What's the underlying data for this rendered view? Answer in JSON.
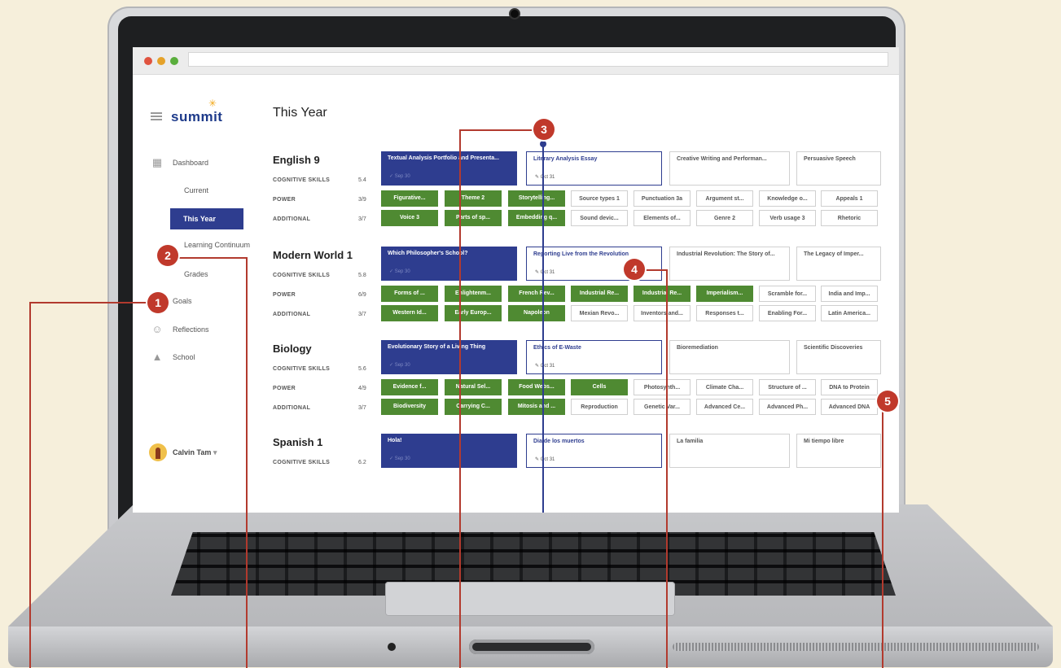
{
  "app": {
    "logo": "summit",
    "page_title": "This Year"
  },
  "sidebar": {
    "items": [
      {
        "label": "Dashboard",
        "icon": "dashboard-icon"
      },
      {
        "label": "Current"
      },
      {
        "label": "This Year",
        "selected": true
      },
      {
        "label": "Learning Continuum"
      },
      {
        "label": "Grades"
      },
      {
        "label": "Goals",
        "icon": "target-icon"
      },
      {
        "label": "Reflections",
        "icon": "smile-icon"
      },
      {
        "label": "School",
        "icon": "graduation-cap-icon"
      }
    ],
    "user": {
      "name": "Calvin Tam",
      "dropdown": "▾"
    }
  },
  "courses": [
    {
      "title": "English 9",
      "rows": [
        {
          "label": "COGNITIVE SKILLS",
          "score": "5.4"
        },
        {
          "label": "POWER",
          "score": "3/9"
        },
        {
          "label": "ADDITIONAL",
          "score": "3/7"
        }
      ],
      "projects": [
        {
          "title": "Textual Analysis Portfolio and Presenta...",
          "date": "✓ Sep 30"
        },
        {
          "title": "Literary Analysis Essay",
          "date": "✎ Oct 31"
        },
        {
          "title": "Creative Writing and Performan..."
        },
        {
          "title": "Persuasive Speech"
        }
      ],
      "power": [
        "Figurative...",
        "Theme 2",
        "Storytelling...",
        "Source types 1",
        "Punctuation 3a",
        "Argument st...",
        "Knowledge o...",
        "Appeals 1"
      ],
      "additional": [
        "Voice 3",
        "Parts of sp...",
        "Embedding q...",
        "Sound devic...",
        "Elements of...",
        "Genre 2",
        "Verb usage 3",
        "Rhetoric"
      ]
    },
    {
      "title": "Modern World 1",
      "rows": [
        {
          "label": "COGNITIVE SKILLS",
          "score": "5.8"
        },
        {
          "label": "POWER",
          "score": "6/9"
        },
        {
          "label": "ADDITIONAL",
          "score": "3/7"
        }
      ],
      "projects": [
        {
          "title": "Which Philosopher's School?",
          "date": "✓ Sep 30"
        },
        {
          "title": "Reporting Live from the Revolution",
          "date": "✎ Oct 31"
        },
        {
          "title": "Industrial Revolution: The Story of..."
        },
        {
          "title": "The Legacy of Imper..."
        }
      ],
      "power": [
        "Forms of ...",
        "Enlightenm...",
        "French Rev...",
        "Industrial Re...",
        "Industrial Re...",
        "Imperialism...",
        "Scramble for...",
        "India and Imp..."
      ],
      "additional": [
        "Western Id...",
        "Early Europ...",
        "Napoleon",
        "Mexian Revo...",
        "Inventors and...",
        "Responses t...",
        "Enabling For...",
        "Latin America..."
      ]
    },
    {
      "title": "Biology",
      "rows": [
        {
          "label": "COGNITIVE SKILLS",
          "score": "5.6"
        },
        {
          "label": "POWER",
          "score": "4/9"
        },
        {
          "label": "ADDITIONAL",
          "score": "3/7"
        }
      ],
      "projects": [
        {
          "title": "Evolutionary Story of a Living Thing",
          "date": "✓ Sep 30"
        },
        {
          "title": "Ethics of E-Waste",
          "date": "✎ Oct 31"
        },
        {
          "title": "Bioremediation"
        },
        {
          "title": "Scientific Discoveries"
        }
      ],
      "power": [
        "Evidence f...",
        "Natural Sel...",
        "Food Webs...",
        "Cells",
        "Photosynth...",
        "Climate Cha...",
        "Structure of ...",
        "DNA to Protein"
      ],
      "additional": [
        "Biodiversity",
        "Carrying C...",
        "Mitosis and ...",
        "Reproduction",
        "Genetic Var...",
        "Advanced Ce...",
        "Advanced Ph...",
        "Advanced DNA"
      ]
    },
    {
      "title": "Spanish 1",
      "rows": [
        {
          "label": "COGNITIVE SKILLS",
          "score": "6.2"
        }
      ],
      "projects": [
        {
          "title": "Hola!",
          "date": "✓ Sep 30"
        },
        {
          "title": "Dia de los muertos",
          "date": "✎ Oct 31"
        },
        {
          "title": "La familia"
        },
        {
          "title": "Mi tiempo libre"
        }
      ]
    }
  ],
  "callouts": [
    "1",
    "2",
    "3",
    "4",
    "5"
  ],
  "colors": {
    "brand_blue": "#2e3d8f",
    "completed_green": "#4f8a32",
    "callout_red": "#c0392b",
    "background": "#f6efdb"
  }
}
